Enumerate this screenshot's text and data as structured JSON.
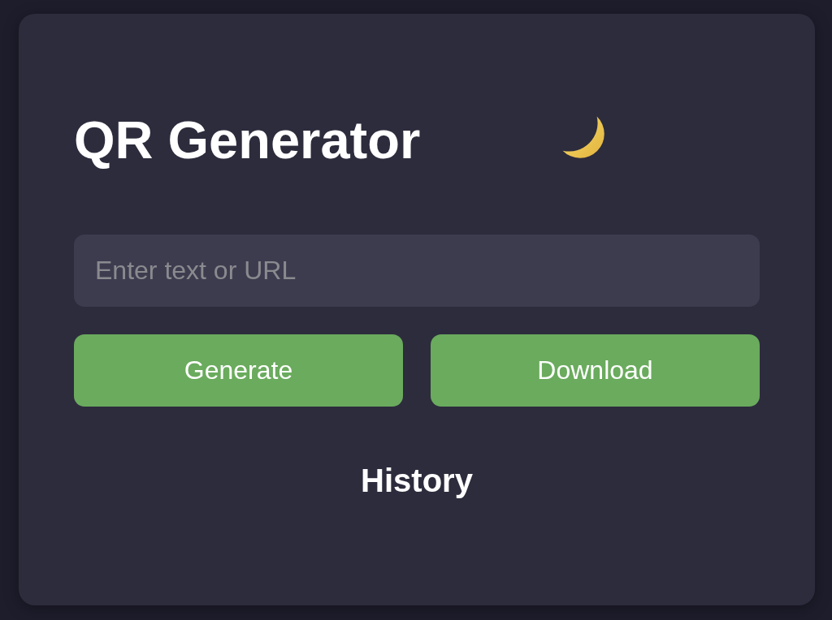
{
  "title": "QR Generator",
  "input": {
    "placeholder": "Enter text or URL"
  },
  "buttons": [
    {
      "label": "Generate"
    },
    {
      "label": "Download"
    }
  ],
  "history": {
    "heading": "History"
  }
}
